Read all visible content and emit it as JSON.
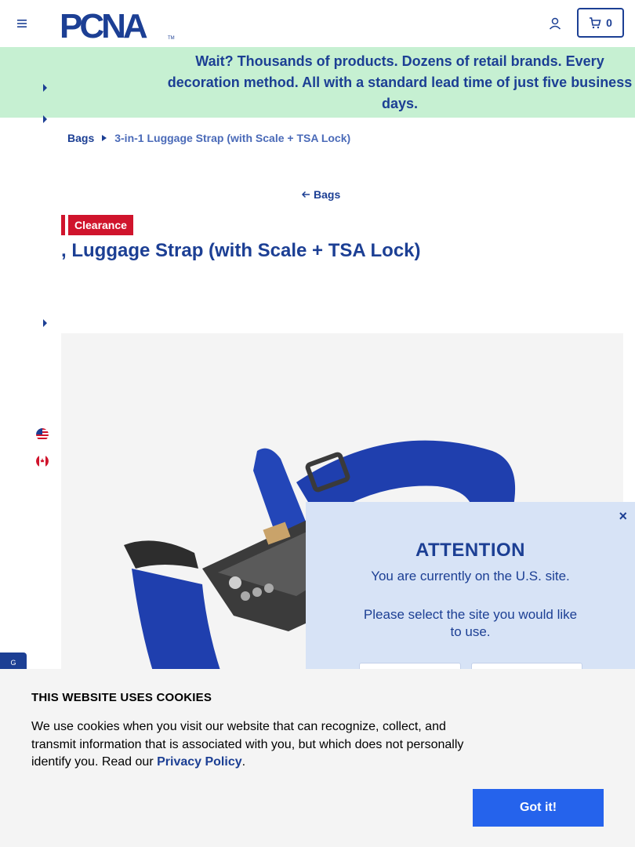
{
  "header": {
    "logo_text": "PCNA",
    "cart_count": "0",
    "icons": {
      "menu": "hamburger-icon",
      "user": "user-icon",
      "cart": "cart-icon"
    }
  },
  "promo": {
    "text": "Wait? Thousands of products. Dozens of retail brands. Every decoration method. All with a standard lead time of just five business days."
  },
  "breadcrumb": {
    "items": [
      "Bags",
      "3-in-1 Luggage Strap (with Scale + TSA Lock)"
    ]
  },
  "back_link": {
    "label": "Bags"
  },
  "product": {
    "badge": "Clearance",
    "title": "3-in-1 Luggage Strap (with Scale + TSA Lock)",
    "title_visible": ", Luggage Strap (with Scale + TSA Lock)"
  },
  "feedback_tab": {
    "label": "G"
  },
  "attention_modal": {
    "title": "ATTENTION",
    "line1": "You are currently on the U.S. site.",
    "line2": "Please select the site you would like to use.",
    "close": "×"
  },
  "cookie_banner": {
    "title": "THIS WEBSITE USES COOKIES",
    "text_before": "We use cookies when you visit our website that can recognize, collect, and transmit information that is associated with you, but which does not personally identify you. Read our ",
    "privacy_link": "Privacy Policy",
    "text_after": ".",
    "button": "Got it!"
  },
  "colors": {
    "brand_blue": "#1c3f94",
    "promo_green": "#c6f0d2",
    "clearance_red": "#d0142c",
    "cta_blue": "#2563ec",
    "modal_bg": "#d7e3f6",
    "strap_blue": "#1f3fae"
  }
}
